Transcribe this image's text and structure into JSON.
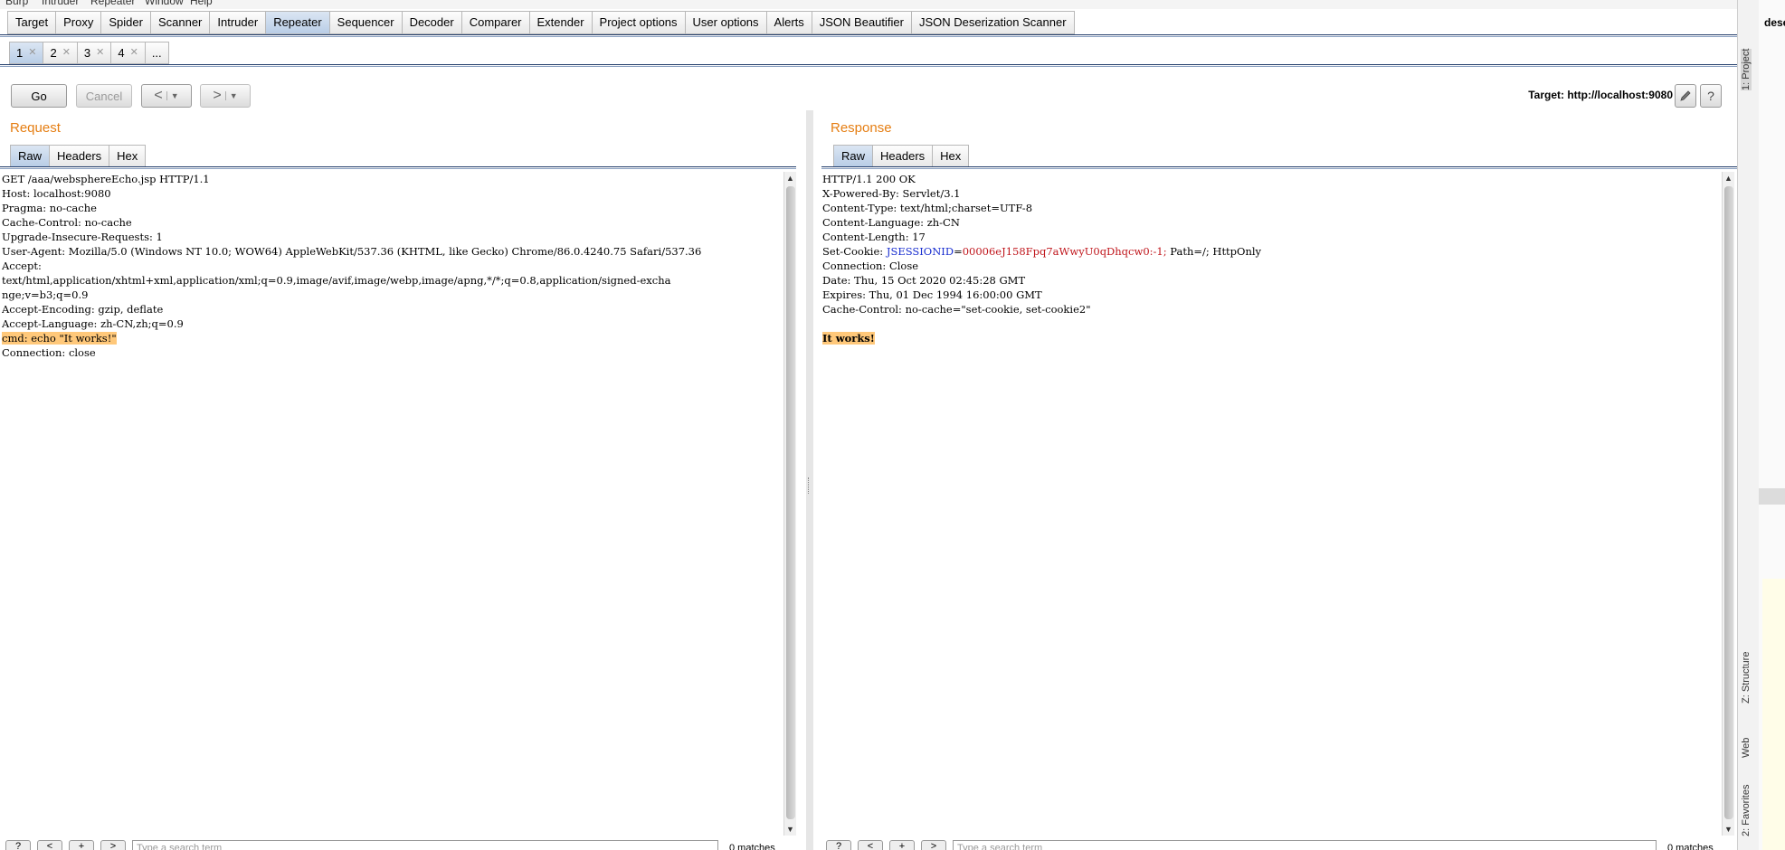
{
  "menu_bar": [
    "Burp",
    "Intruder",
    "Repeater",
    "Window",
    "Help"
  ],
  "tool_tabs": [
    "Target",
    "Proxy",
    "Spider",
    "Scanner",
    "Intruder",
    "Repeater",
    "Sequencer",
    "Decoder",
    "Comparer",
    "Extender",
    "Project options",
    "User options",
    "Alerts",
    "JSON Beautifier",
    "JSON Deserization Scanner"
  ],
  "active_tool_tab": "Repeater",
  "repeater_tabs": [
    "1",
    "2",
    "3",
    "4",
    "..."
  ],
  "active_repeater_tab": "1",
  "toolbar": {
    "go_label": "Go",
    "cancel_label": "Cancel",
    "back_arrow": "<",
    "forward_arrow": ">",
    "dropdown_glyph": "▼",
    "target_text": "Target: http://localhost:9080",
    "edit_icon": "pencil-icon",
    "help_label": "?"
  },
  "request": {
    "title": "Request",
    "tabs": [
      "Raw",
      "Headers",
      "Hex"
    ],
    "active_tab": "Raw",
    "lines": [
      "GET /aaa/websphereEcho.jsp HTTP/1.1",
      "Host: localhost:9080",
      "Pragma: no-cache",
      "Cache-Control: no-cache",
      "Upgrade-Insecure-Requests: 1",
      "User-Agent: Mozilla/5.0 (Windows NT 10.0; WOW64) AppleWebKit/537.36 (KHTML, like Gecko) Chrome/86.0.4240.75 Safari/537.36",
      "Accept:",
      "text/html,application/xhtml+xml,application/xml;q=0.9,image/avif,image/webp,image/apng,*/*;q=0.8,application/signed-excha",
      "nge;v=b3;q=0.9",
      "Accept-Encoding: gzip, deflate",
      "Accept-Language: zh-CN,zh;q=0.9",
      "cmd: echo \"It works!\"",
      "Connection: close"
    ],
    "search": {
      "help": "?",
      "prev": "<",
      "add": "+",
      "next": ">",
      "placeholder": "Type a search term",
      "matches": "0 matches"
    }
  },
  "response": {
    "title": "Response",
    "tabs": [
      "Raw",
      "Headers",
      "Hex"
    ],
    "active_tab": "Raw",
    "lines": [
      "HTTP/1.1 200 OK",
      "X-Powered-By: Servlet/3.1",
      "Content-Type: text/html;charset=UTF-8",
      "Content-Language: zh-CN",
      "Content-Length: 17",
      "Connection: Close",
      "Date: Thu, 15 Oct 2020 02:45:28 GMT",
      "Expires: Thu, 01 Dec 1994 16:00:00 GMT",
      "Cache-Control: no-cache=\"set-cookie, set-cookie2\""
    ],
    "cookie": {
      "prefix": "Set-Cookie: ",
      "name": "JSESSIONID",
      "eq": "=",
      "value": "00006eJ158Fpq7aWwyU0qDhqcw0:-1;",
      "suffix": " Path=/; HttpOnly"
    },
    "body": "It works!",
    "search": {
      "help": "?",
      "prev": "<",
      "add": "+",
      "next": ">",
      "placeholder": "Type a search term",
      "matches": "0 matches"
    }
  },
  "ide_sidebar": {
    "project": "1: Project",
    "structure": "Z: Structure",
    "web": "Web",
    "favorites": "2: Favorites",
    "tab_text": "dese"
  },
  "colors": {
    "pane_title": "#e57e13",
    "highlight": "#ffc87a",
    "cookie_name": "#1a2fd0",
    "cookie_value": "#c0171d",
    "active_tab": "#b9cde6"
  }
}
